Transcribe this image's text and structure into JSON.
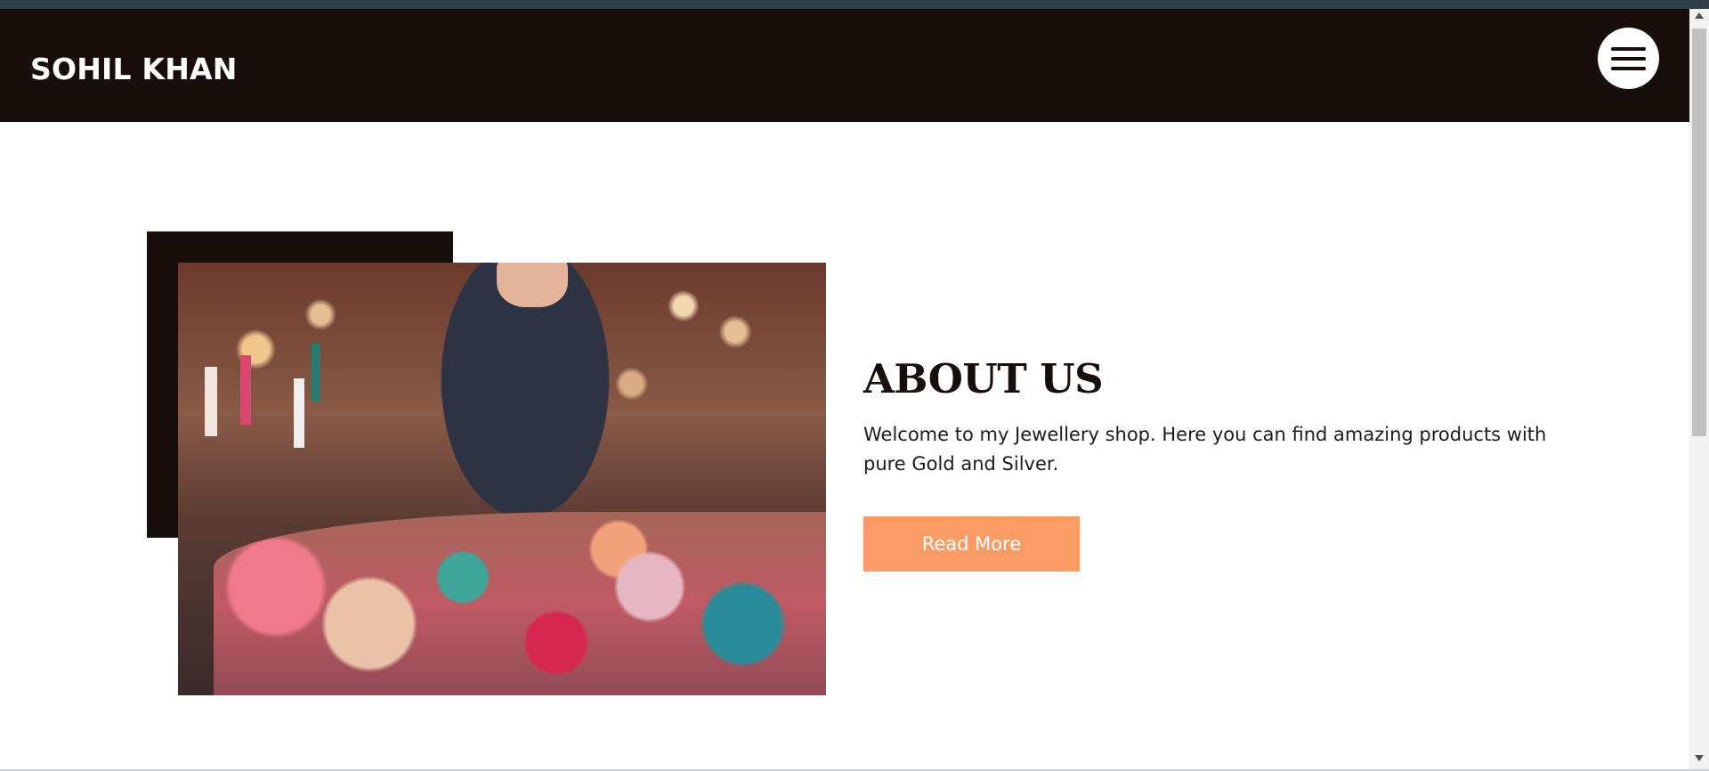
{
  "header": {
    "brand": "SOHIL KHAN",
    "menu_icon": "hamburger-menu-icon"
  },
  "about": {
    "title": "ABOUT US",
    "description": "Welcome to my Jewellery shop. Here you can find amazing products with pure Gold and Silver.",
    "button_label": "Read More"
  },
  "colors": {
    "nav_background": "#170d0b",
    "button_background": "#fb9b66",
    "brand_text": "#ffffff"
  }
}
